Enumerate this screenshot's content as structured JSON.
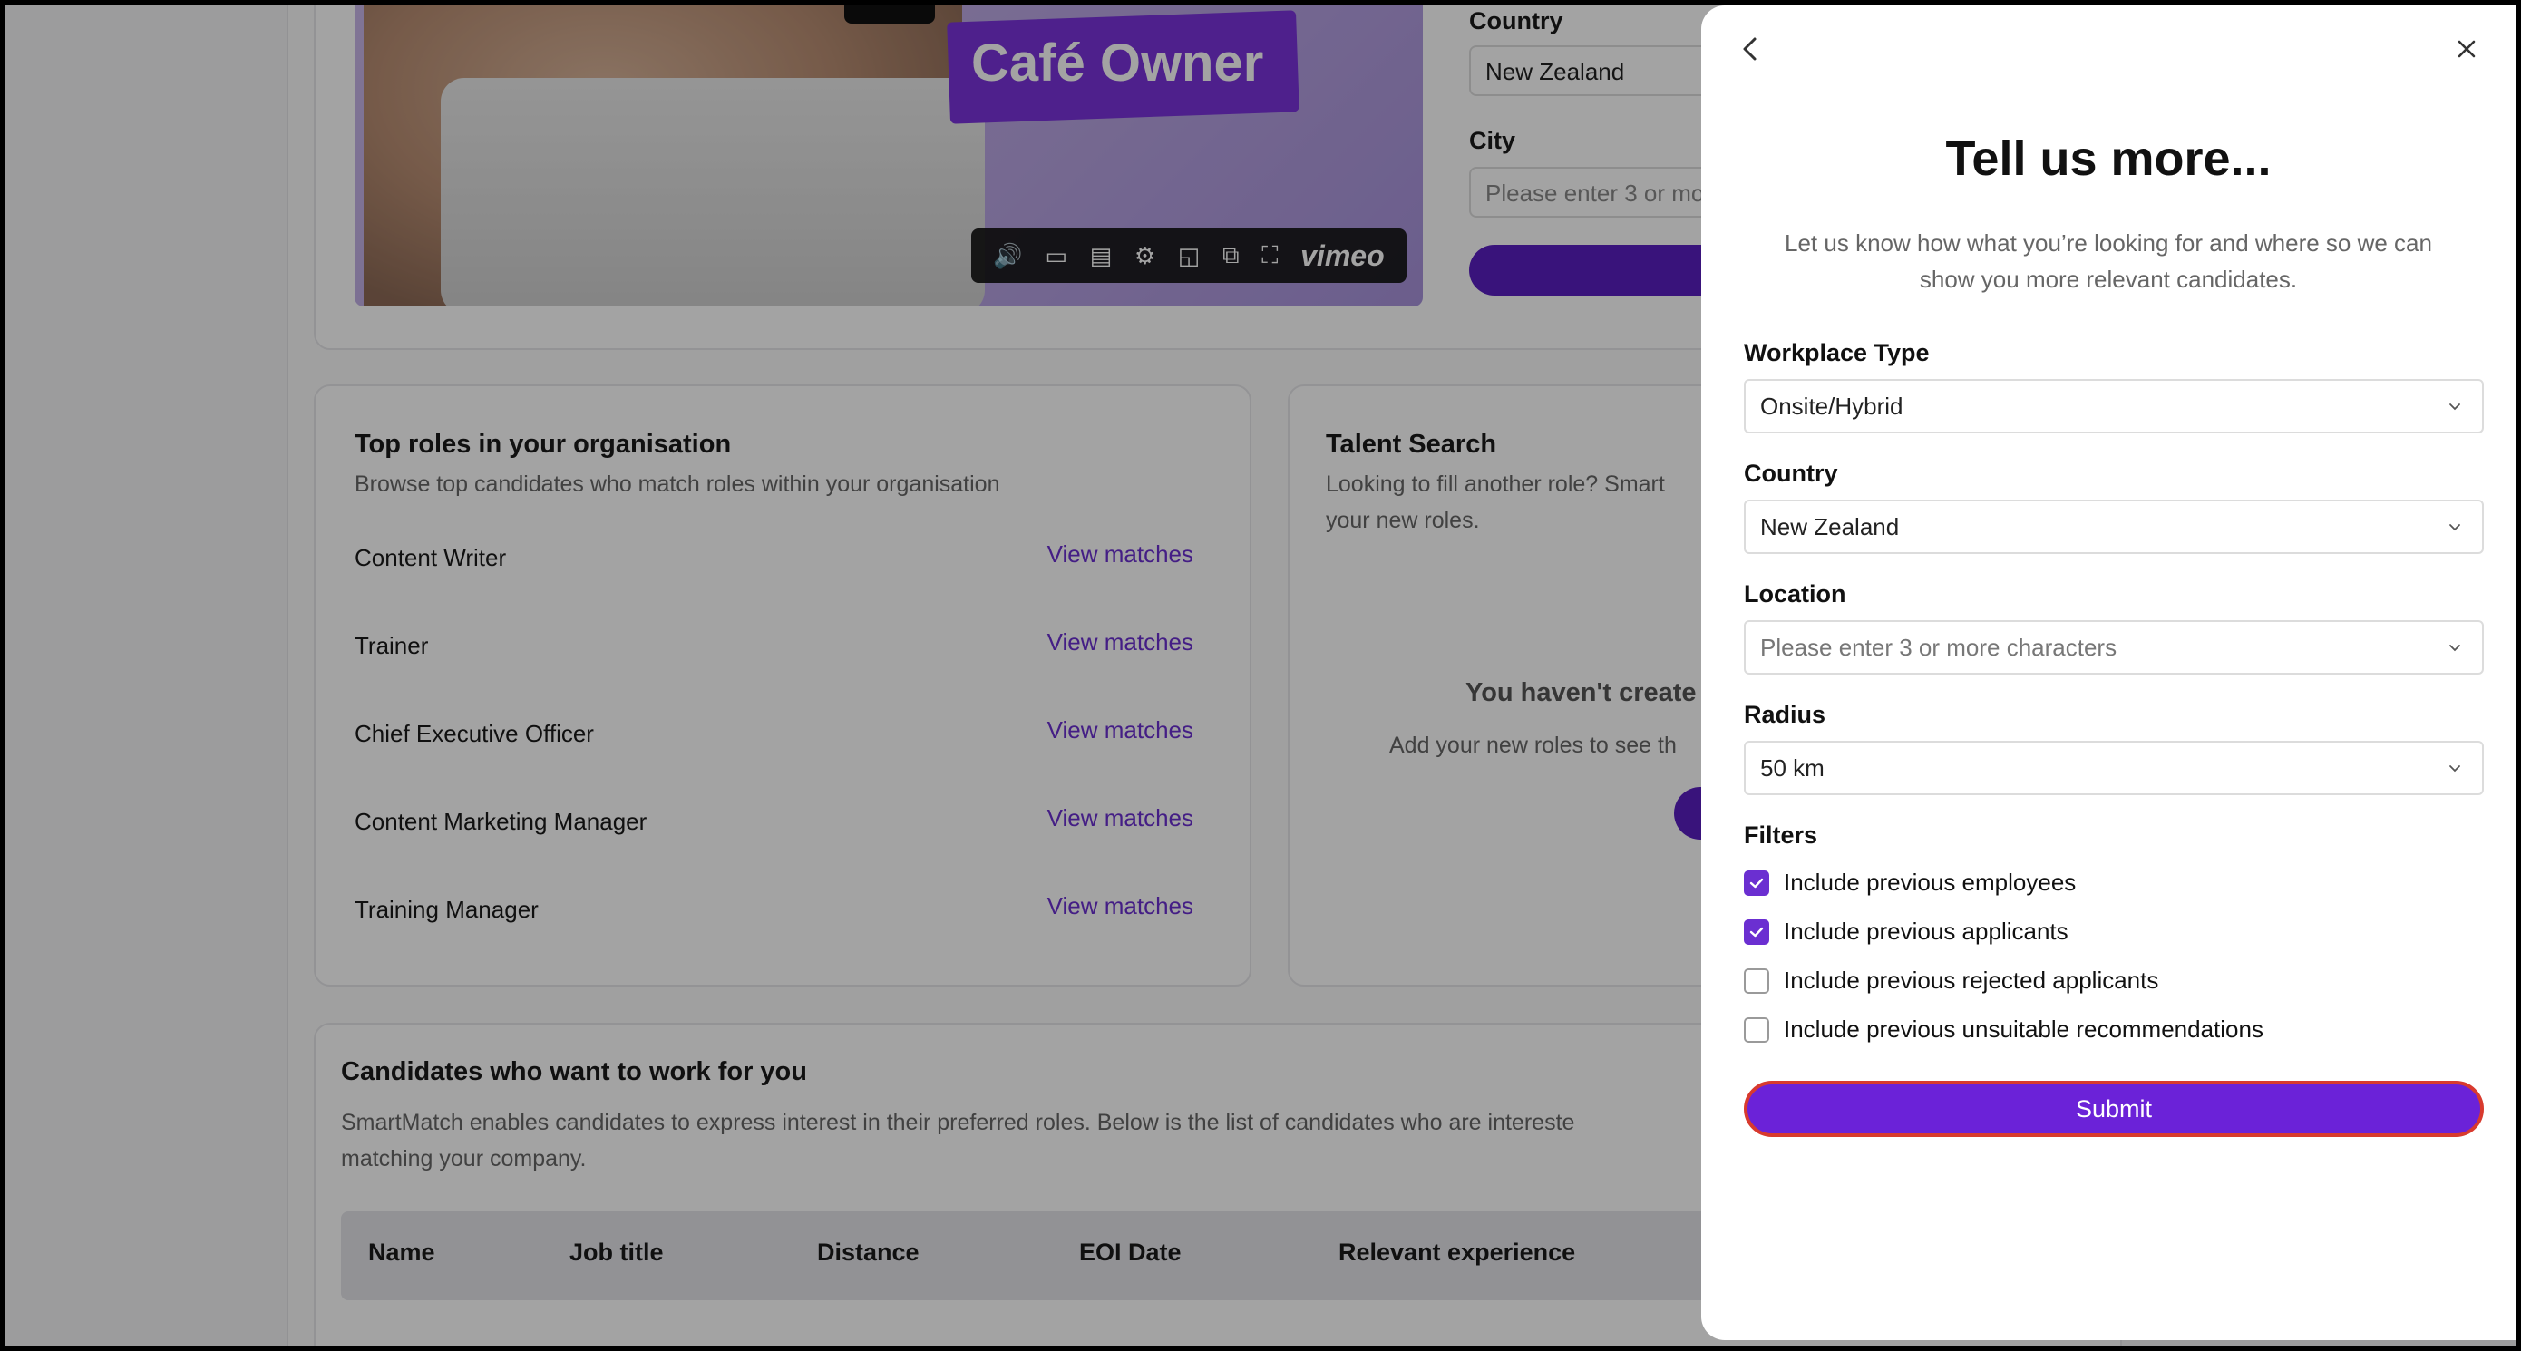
{
  "background": {
    "video": {
      "overlay_text": "Café Owner",
      "brand": "vimeo"
    },
    "country_label": "Country",
    "country_value": "New Zealand",
    "city_label": "City",
    "city_placeholder": "Please enter 3 or more characters",
    "top_roles": {
      "title": "Top roles in your organisation",
      "subtitle": "Browse top candidates who match roles within your organisation",
      "roles": [
        {
          "name": "Content Writer",
          "action": "View matches"
        },
        {
          "name": "Trainer",
          "action": "View matches"
        },
        {
          "name": "Chief Executive Officer",
          "action": "View matches"
        },
        {
          "name": "Content Marketing Manager",
          "action": "View matches"
        },
        {
          "name": "Training Manager",
          "action": "View matches"
        }
      ]
    },
    "talent_search": {
      "title": "Talent Search",
      "subtitle_line1": "Looking to fill another role? Smart",
      "subtitle_line2": "your new roles.",
      "empty_title": "You haven't create",
      "empty_sub": "Add your new roles to see th"
    },
    "candidates": {
      "title": "Candidates who want to work for you",
      "description_line1": "SmartMatch enables candidates to express interest in their preferred roles. Below is the list of candidates who are intereste",
      "description_line2": "matching your company.",
      "columns": [
        "Name",
        "Job title",
        "Distance",
        "EOI Date",
        "Relevant experience"
      ]
    }
  },
  "drawer": {
    "title": "Tell us more...",
    "subtitle": "Let us know how what you’re looking for and where so we can show you more relevant candidates.",
    "workplace_type": {
      "label": "Workplace Type",
      "value": "Onsite/Hybrid"
    },
    "country": {
      "label": "Country",
      "value": "New Zealand"
    },
    "location": {
      "label": "Location",
      "placeholder": "Please enter 3 or more characters"
    },
    "radius": {
      "label": "Radius",
      "value": "50 km"
    },
    "filters": {
      "label": "Filters",
      "options": [
        {
          "label": "Include previous employees",
          "checked": true
        },
        {
          "label": "Include previous applicants",
          "checked": true
        },
        {
          "label": "Include previous rejected applicants",
          "checked": false
        },
        {
          "label": "Include previous unsuitable recommendations",
          "checked": false
        }
      ]
    },
    "submit_label": "Submit"
  },
  "colors": {
    "accent": "#6b22d8",
    "submit_outline": "#d83a2e",
    "link": "#6b2fd1"
  }
}
